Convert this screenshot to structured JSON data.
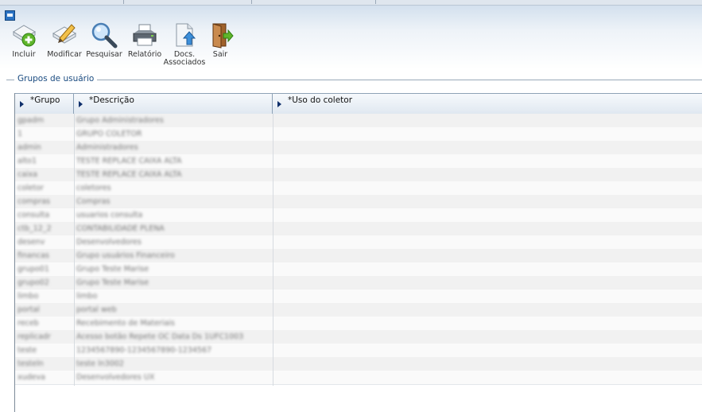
{
  "toolbar": {
    "buttons": [
      {
        "label": "Incluir",
        "icon": "add-document-icon"
      },
      {
        "label": "Modificar",
        "icon": "edit-pencil-icon"
      },
      {
        "label": "Pesquisar",
        "icon": "magnifier-icon"
      },
      {
        "label": "Relatório",
        "icon": "printer-icon"
      },
      {
        "label_line1": "Docs.",
        "label_line2": "Associados",
        "icon": "upload-document-icon"
      },
      {
        "label": "Sair",
        "icon": "exit-door-icon"
      }
    ]
  },
  "section": {
    "title": "Grupos de usuário"
  },
  "grid": {
    "columns": [
      "*Grupo",
      "*Descrição",
      "*Uso do coletor"
    ],
    "rows": [
      {
        "grupo": "gpadm",
        "descricao": "Grupo Administradores",
        "uso": ""
      },
      {
        "grupo": "1",
        "descricao": "GRUPO COLETOR",
        "uso": ""
      },
      {
        "grupo": "admin",
        "descricao": "Administradores",
        "uso": ""
      },
      {
        "grupo": "alto1",
        "descricao": "TESTE REPLACE CAIXA ALTA",
        "uso": ""
      },
      {
        "grupo": "caixa",
        "descricao": "TESTE REPLACE CAIXA ALTA",
        "uso": ""
      },
      {
        "grupo": "coletor",
        "descricao": "coletores",
        "uso": ""
      },
      {
        "grupo": "compras",
        "descricao": "Compras",
        "uso": ""
      },
      {
        "grupo": "consulta",
        "descricao": "usuarios consulta",
        "uso": ""
      },
      {
        "grupo": "ctb_12_2",
        "descricao": "CONTABILIDADE PLENA",
        "uso": ""
      },
      {
        "grupo": "desenv",
        "descricao": "Desenvolvedores",
        "uso": ""
      },
      {
        "grupo": "financas",
        "descricao": "Grupo usuários Financeiro",
        "uso": ""
      },
      {
        "grupo": "grupo01",
        "descricao": "Grupo Teste Marise",
        "uso": ""
      },
      {
        "grupo": "grupo02",
        "descricao": "Grupo Teste Marise",
        "uso": ""
      },
      {
        "grupo": "limbo",
        "descricao": "limbo",
        "uso": ""
      },
      {
        "grupo": "portal",
        "descricao": "portal web",
        "uso": ""
      },
      {
        "grupo": "receb",
        "descricao": "Recebimento de Materiais",
        "uso": ""
      },
      {
        "grupo": "replicadr",
        "descricao": "Acesso botão Repete OC Data Ds 1UFC1003",
        "uso": ""
      },
      {
        "grupo": "teste",
        "descricao": "1234567890-1234567890-1234567",
        "uso": ""
      },
      {
        "grupo": "testeln",
        "descricao": "teste ln3002",
        "uso": ""
      },
      {
        "grupo": "xudeva",
        "descricao": "Desenvolvedores UX",
        "uso": ""
      }
    ]
  },
  "colors": {
    "header_text": "#1a4b80",
    "accent": "#2a72c3"
  }
}
